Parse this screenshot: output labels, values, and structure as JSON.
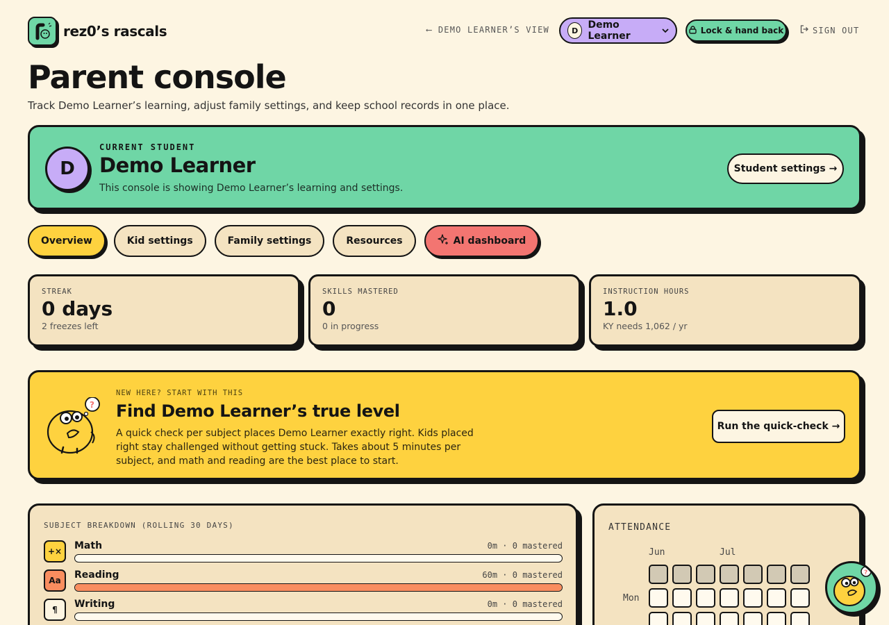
{
  "brand": {
    "name": "rez0’s rascals"
  },
  "header": {
    "back_label": "DEMO LEARNER’S VIEW",
    "learner_initial": "D",
    "learner_name": "Demo Learner",
    "lock_label": "Lock & hand back",
    "signout_label": "SIGN OUT"
  },
  "page": {
    "title": "Parent console",
    "subtitle": "Track Demo Learner’s learning, adjust family settings, and keep school records in one place."
  },
  "student": {
    "eyebrow": "CURRENT STUDENT",
    "initial": "D",
    "name": "Demo Learner",
    "desc": "This console is showing Demo Learner’s learning and settings.",
    "settings_label": "Student settings →"
  },
  "tabs": [
    {
      "label": "Overview"
    },
    {
      "label": "Kid settings"
    },
    {
      "label": "Family settings"
    },
    {
      "label": "Resources"
    },
    {
      "label": "AI dashboard"
    }
  ],
  "stats": [
    {
      "label": "STREAK",
      "value": "0 days",
      "sub": "2 freezes left"
    },
    {
      "label": "SKILLS MASTERED",
      "value": "0",
      "sub": "0 in progress"
    },
    {
      "label": "INSTRUCTION HOURS",
      "value": "1.0",
      "sub": "KY needs 1,062 / yr"
    }
  ],
  "quick": {
    "eyebrow": "NEW HERE? START WITH THIS",
    "title": "Find Demo Learner’s true level",
    "body": "A quick check per subject places Demo Learner exactly right. Kids placed right stay challenged without getting stuck. Takes about 5 minutes per subject, and math and reading are the best place to start.",
    "button_label": "Run the quick-check →"
  },
  "subjects": {
    "label": "SUBJECT BREAKDOWN (ROLLING 30 DAYS)",
    "rows": [
      {
        "icon": "+×",
        "name": "Math",
        "stat": "0m · 0 mastered",
        "progress": 0,
        "icon_color": "#fed23f"
      },
      {
        "icon": "Aa",
        "name": "Reading",
        "stat": "60m · 0 mastered",
        "progress": 1,
        "icon_color": "#f98d5f"
      },
      {
        "icon": "¶",
        "name": "Writing",
        "stat": "0m · 0 mastered",
        "progress": 0,
        "icon_color": "#fdf5e2"
      }
    ]
  },
  "attendance": {
    "label": "ATTENDANCE",
    "months": [
      "Jun",
      "Jul"
    ],
    "day_label": "Mon"
  },
  "colors": {
    "mint": "#6fd6a6",
    "lavender": "#c7acf7",
    "yellow": "#fed23f",
    "coral": "#f37571",
    "cream": "#fdf5e2",
    "card": "#f4e3c1",
    "ink": "#141414"
  }
}
